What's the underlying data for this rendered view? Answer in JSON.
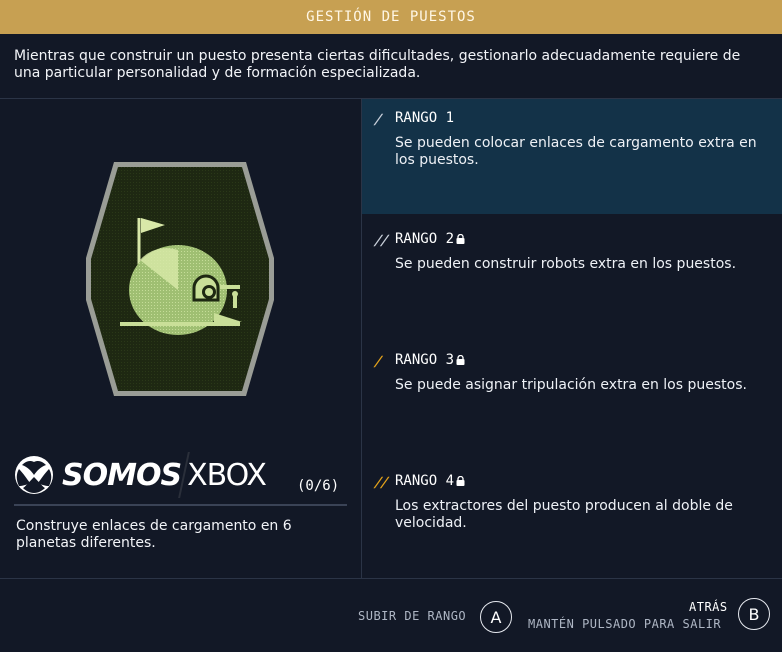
{
  "header": {
    "title": "GESTIÓN DE PUESTOS"
  },
  "intro": "Mientras que construir un puesto presenta ciertas dificultades, gestionarlo adecuadamente requiere de una particular personalidad y de formación especializada.",
  "watermark": {
    "word1": "SOMOS",
    "word2": "XBOX"
  },
  "challenge": {
    "progress": "(0/6)",
    "description": "Construye enlaces de cargamento en 6 planetas diferentes."
  },
  "ranks": [
    {
      "title": "RANGO 1",
      "marker": "/",
      "locked": false,
      "active": true,
      "description": "Se pueden colocar enlaces de cargamento extra en los puestos.",
      "marker_color": "#c9d0da"
    },
    {
      "title": "RANGO 2",
      "marker": "//",
      "locked": true,
      "active": false,
      "description": "Se pueden construir robots extra en los puestos.",
      "marker_color": "#c9d0da"
    },
    {
      "title": "RANGO 3",
      "marker": "/",
      "locked": true,
      "active": false,
      "description": "Se puede asignar tripulación extra en los puestos.",
      "marker_color": "#e3a21a"
    },
    {
      "title": "RANGO 4",
      "marker": "//",
      "locked": true,
      "active": false,
      "description": "Los extractores del puesto producen al doble de velocidad.",
      "marker_color": "#e3a21a"
    }
  ],
  "footer": {
    "rank_up_label": "SUBIR DE RANGO",
    "rank_up_button": "A",
    "back_label": "ATRÁS",
    "back_hint": "MANTÉN PULSADO PARA SALIR",
    "back_button": "B"
  },
  "colors": {
    "header_bg": "#c7a052",
    "background": "#121826",
    "active_rank_bg": "#133248",
    "badge_green": "#1f2a12"
  }
}
